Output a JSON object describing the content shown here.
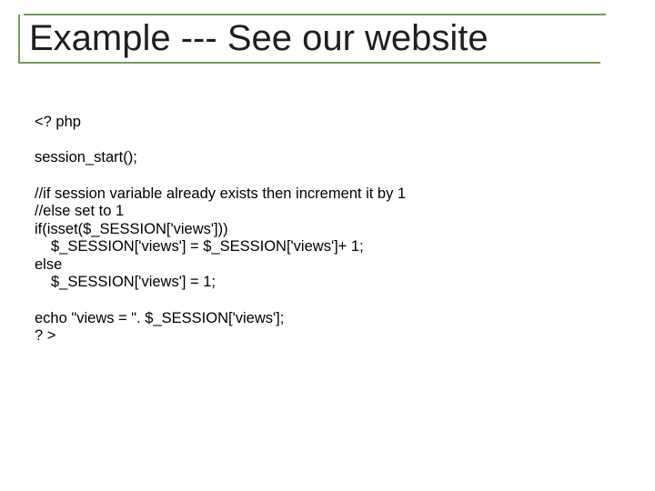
{
  "title": "Example --- See our website",
  "code": {
    "l1": "<? php",
    "l2": "session_start();",
    "l3": "//if session variable already exists then increment it by 1",
    "l4": "//else set to 1",
    "l5": "if(isset($_SESSION['views']))",
    "l6": "$_SESSION['views'] = $_SESSION['views']+ 1;",
    "l7": "else",
    "l8": "$_SESSION['views'] = 1;",
    "l9": "echo \"views = \". $_SESSION['views'];",
    "l10": "? >"
  }
}
